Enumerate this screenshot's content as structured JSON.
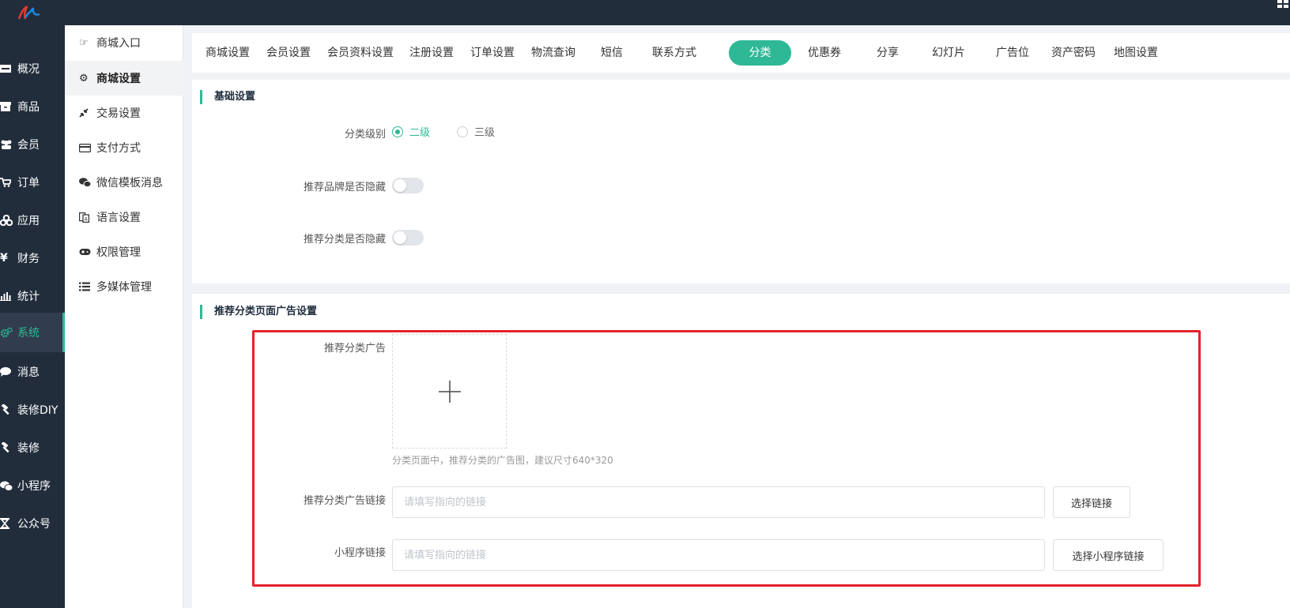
{
  "colors": {
    "accent": "#2fb896",
    "nav_bg": "#222d3c",
    "highlight": "#e5222a"
  },
  "logo": "logo-icon",
  "nav": {
    "items": [
      {
        "label": "概况",
        "icon": "inbox-icon"
      },
      {
        "label": "商品",
        "icon": "archive-icon"
      },
      {
        "label": "会员",
        "icon": "users-icon"
      },
      {
        "label": "订单",
        "icon": "cart-icon"
      },
      {
        "label": "应用",
        "icon": "apps-icon"
      },
      {
        "label": "财务",
        "icon": "yen-icon"
      },
      {
        "label": "统计",
        "icon": "bar-chart-icon"
      },
      {
        "label": "系统",
        "icon": "gears-icon",
        "active": true
      },
      {
        "label": "消息",
        "icon": "chat-icon"
      },
      {
        "label": "装修DIY",
        "icon": "hammer-icon"
      },
      {
        "label": "装修",
        "icon": "hammer-icon"
      },
      {
        "label": "小程序",
        "icon": "wechat-icon"
      },
      {
        "label": "公众号",
        "icon": "hourglass-icon"
      }
    ]
  },
  "submenu": {
    "items": [
      {
        "label": "商城入口",
        "icon": "hand-point-icon"
      },
      {
        "label": "商城设置",
        "icon": "gear-icon",
        "active": true
      },
      {
        "label": "交易设置",
        "icon": "compress-icon"
      },
      {
        "label": "支付方式",
        "icon": "credit-card-icon"
      },
      {
        "label": "微信模板消息",
        "icon": "wechat-icon"
      },
      {
        "label": "语言设置",
        "icon": "language-icon"
      },
      {
        "label": "权限管理",
        "icon": "gamepad-icon"
      },
      {
        "label": "多媒体管理",
        "icon": "list-icon"
      }
    ]
  },
  "tabs": [
    {
      "label": "商城设置"
    },
    {
      "label": "会员设置"
    },
    {
      "label": "会员资料设置"
    },
    {
      "label": "注册设置"
    },
    {
      "label": "订单设置"
    },
    {
      "label": "物流查询"
    },
    {
      "label": "短信"
    },
    {
      "label": "联系方式"
    },
    {
      "label": "分类",
      "active": true
    },
    {
      "label": "优惠券"
    },
    {
      "label": "分享"
    },
    {
      "label": "幻灯片"
    },
    {
      "label": "广告位"
    },
    {
      "label": "资产密码"
    },
    {
      "label": "地图设置"
    }
  ],
  "basic": {
    "title": "基础设置",
    "level_label": "分类级别",
    "level_options": [
      "二级",
      "三级"
    ],
    "level_selected": "二级",
    "brand_hidden_label": "推荐品牌是否隐藏",
    "brand_hidden": false,
    "category_hidden_label": "推荐分类是否隐藏",
    "category_hidden": false
  },
  "ad": {
    "title": "推荐分类页面广告设置",
    "ad_label": "推荐分类广告",
    "hint": "分类页面中，推荐分类的广告图，建议尺寸640*320",
    "link_label": "推荐分类广告链接",
    "link_placeholder": "请填写指向的链接",
    "link_button": "选择链接",
    "mini_label": "小程序链接",
    "mini_placeholder": "请填写指向的链接",
    "mini_button": "选择小程序链接"
  }
}
